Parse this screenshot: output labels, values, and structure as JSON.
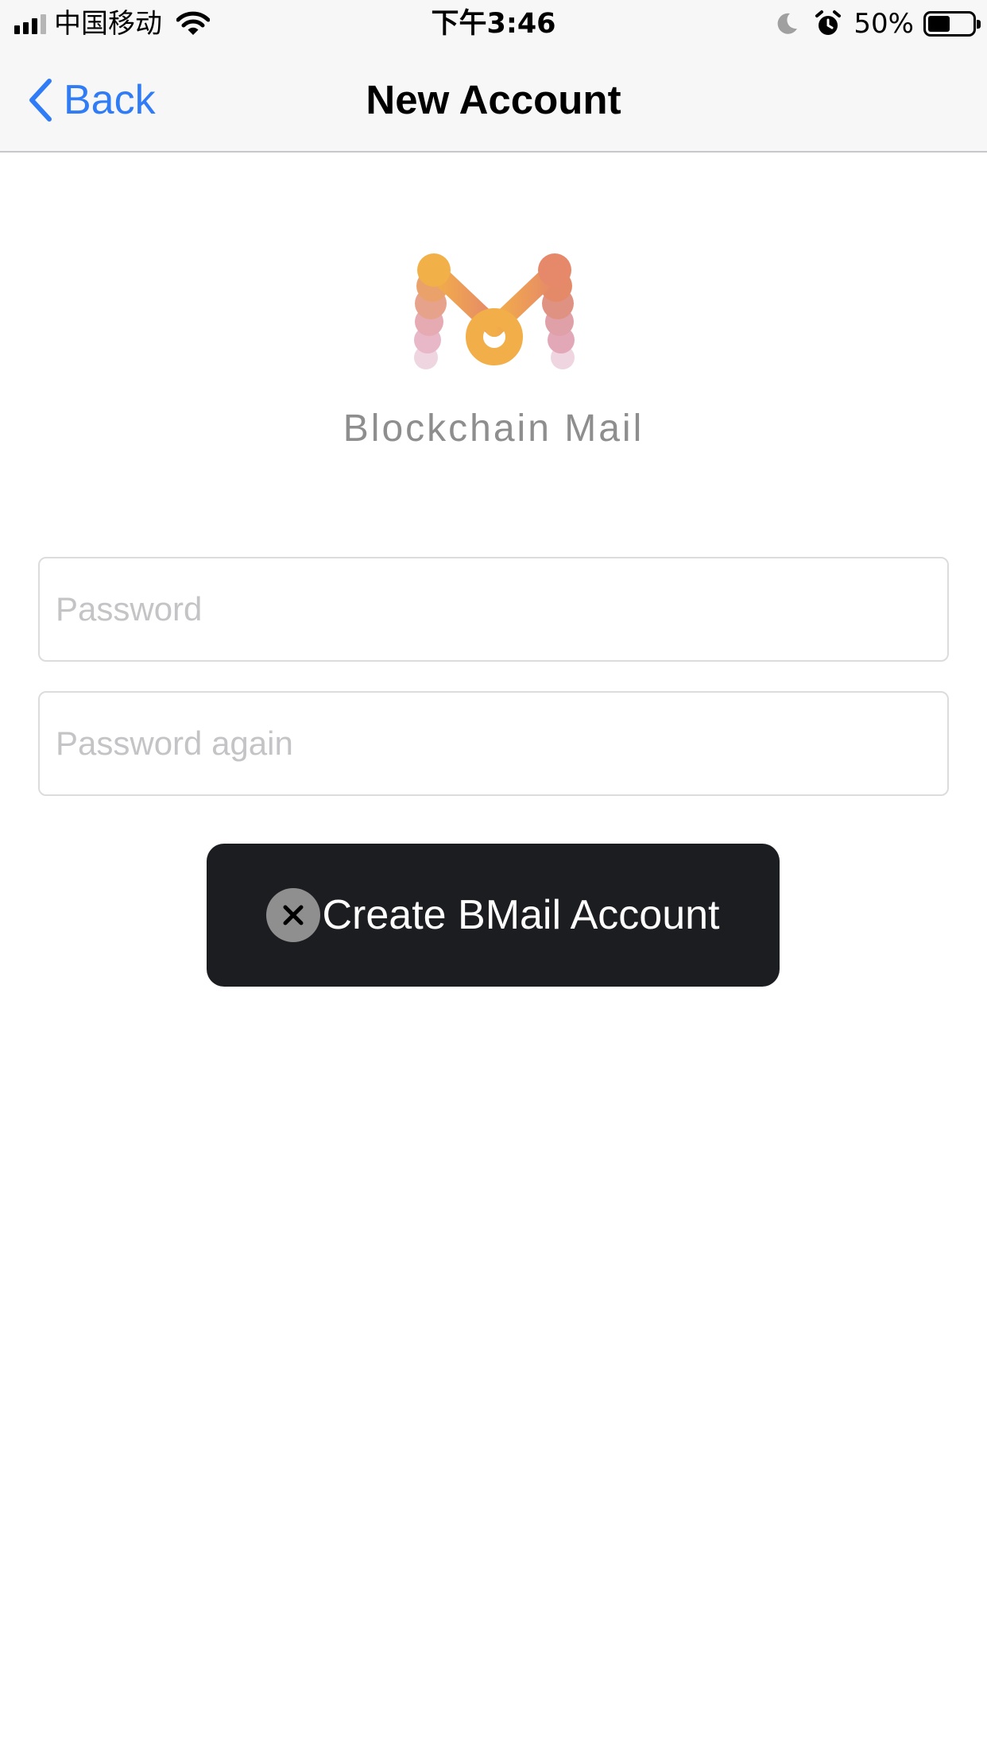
{
  "status_bar": {
    "carrier": "中国移动",
    "time": "下午3:46",
    "battery_percent": "50%",
    "battery_level": 0.5,
    "icons": [
      "signal-icon",
      "wifi-icon",
      "moon-icon",
      "alarm-icon",
      "battery-icon"
    ]
  },
  "nav": {
    "back_label": "Back",
    "title": "New Account"
  },
  "brand": {
    "logo_icon": "blockchain-mail-logo-icon",
    "name": "Blockchain Mail",
    "colors": {
      "orange": "#F2AE48",
      "coral": "#E6886A",
      "pink": "#E6B3C8"
    }
  },
  "form": {
    "password_placeholder": "Password",
    "password_value": "",
    "password_again_placeholder": "Password again",
    "password_again_value": ""
  },
  "create_button": {
    "label": "Create BMail Account",
    "icon": "close-circle-icon"
  },
  "colors": {
    "accent": "#2F7CF6",
    "button_bg": "#1C1D21",
    "nav_bg": "#F7F7F7"
  }
}
